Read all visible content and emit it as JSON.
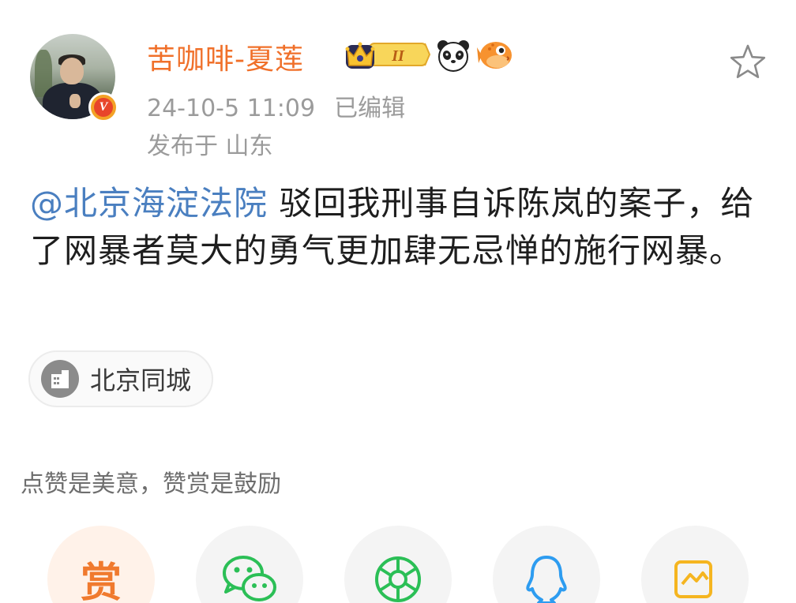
{
  "author": {
    "name": "苦咖啡-夏莲",
    "level_badge": "II",
    "emojis": [
      "panda-emoji-icon",
      "pufferfish-emoji-icon"
    ],
    "verified_mark": "V",
    "avatar_icon": "user-avatar"
  },
  "meta": {
    "timestamp": "24-10-5 11:09",
    "edited_label": "已编辑",
    "location_label": "发布于 山东"
  },
  "post": {
    "mention": "@北京海淀法院",
    "text": " 驳回我刑事自诉陈岚的案子，给了网暴者莫大的勇气更加肆无忌惮的施行网暴。"
  },
  "tag": {
    "label": "北京同城",
    "icon": "city-building-icon"
  },
  "reward": {
    "hint": "点赞是美意，赞赏是鼓励",
    "button_char": "赏"
  },
  "share_targets": [
    {
      "name": "reward",
      "icon": "reward-icon"
    },
    {
      "name": "wechat",
      "icon": "wechat-icon",
      "color": "#2bbf56"
    },
    {
      "name": "moments",
      "icon": "wechat-moments-icon",
      "color": "#2bbf56"
    },
    {
      "name": "qq",
      "icon": "qq-icon",
      "color": "#2d9cf0"
    },
    {
      "name": "qzone",
      "icon": "qzone-icon",
      "color": "#f5b520"
    }
  ],
  "colors": {
    "username": "#f0702a",
    "mention": "#4a7fc0",
    "meta": "#9b9b9b"
  }
}
